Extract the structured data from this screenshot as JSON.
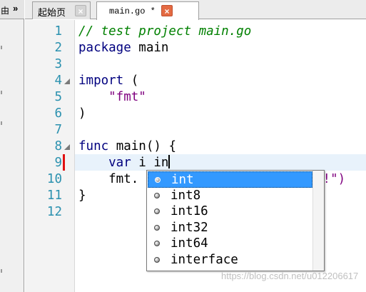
{
  "left_panel": {
    "tab_label": "由",
    "expand_glyph": "»"
  },
  "tabs": [
    {
      "label": "起始页",
      "close": "×",
      "active": false
    },
    {
      "label": "main.go *",
      "close": "×",
      "active": true
    }
  ],
  "editor": {
    "line_numbers": [
      "1",
      "2",
      "3",
      "4",
      "5",
      "6",
      "7",
      "8",
      "9",
      "10",
      "11",
      "12"
    ],
    "current_line": 9,
    "lines": [
      [
        {
          "c": "cm",
          "t": "// test project main.go"
        }
      ],
      [
        {
          "c": "kw",
          "t": "package"
        },
        {
          "c": "tx",
          "t": " main"
        }
      ],
      [],
      [
        {
          "c": "kw",
          "t": "import"
        },
        {
          "c": "tx",
          "t": " ("
        }
      ],
      [
        {
          "c": "st",
          "t": "    \"fmt\""
        }
      ],
      [
        {
          "c": "tx",
          "t": ")"
        }
      ],
      [],
      [
        {
          "c": "kw",
          "t": "func"
        },
        {
          "c": "tx",
          "t": " main() {"
        }
      ],
      [
        {
          "c": "kw",
          "t": "    var"
        },
        {
          "c": "tx",
          "t": " i in"
        }
      ],
      [
        {
          "c": "tx",
          "t": "    fmt."
        }
      ],
      [
        {
          "c": "tx",
          "t": "}"
        }
      ],
      []
    ],
    "hidden_line_tail": "d!\")"
  },
  "autocomplete": {
    "items": [
      "int",
      "int8",
      "int16",
      "int32",
      "int64",
      "interface"
    ],
    "selected_index": 0
  },
  "watermark": "https://blog.csdn.net/u012206617",
  "colors": {
    "keyword": "#00007f",
    "comment": "#008000",
    "string": "#7f007f",
    "line_number": "#2b91af",
    "selection": "#3399ff",
    "close_active": "#e46a42"
  }
}
